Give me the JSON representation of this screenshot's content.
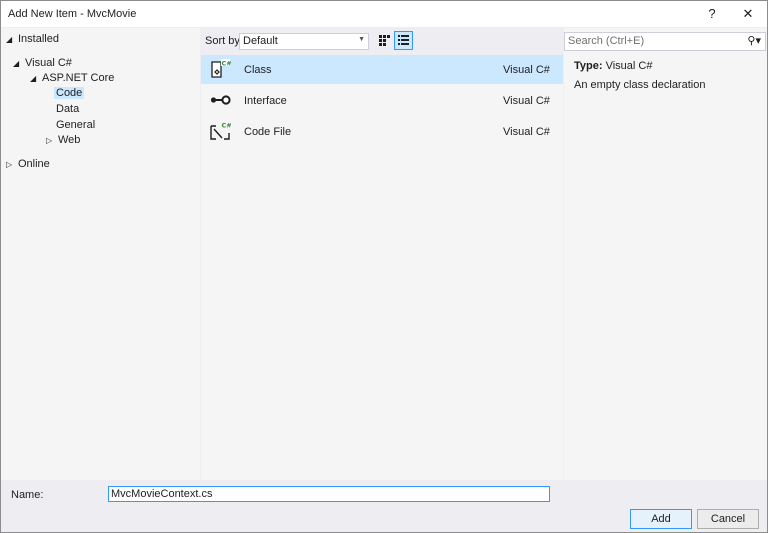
{
  "window": {
    "title": "Add New Item - MvcMovie",
    "help_label": "?",
    "close_label": "✕"
  },
  "tree": {
    "installed": "Installed",
    "visual_csharp": "Visual C#",
    "aspnet_core": "ASP.NET Core",
    "code": "Code",
    "data": "Data",
    "general": "General",
    "web": "Web",
    "online": "Online"
  },
  "toolbar": {
    "sort_label": "Sort by:",
    "sort_value": "Default"
  },
  "items": [
    {
      "name": "Class",
      "language": "Visual C#"
    },
    {
      "name": "Interface",
      "language": "Visual C#"
    },
    {
      "name": "Code File",
      "language": "Visual C#"
    }
  ],
  "details": {
    "search_placeholder": "Search (Ctrl+E)",
    "type_label": "Type:",
    "type_value": "Visual C#",
    "description": "An empty class declaration"
  },
  "footer": {
    "name_label": "Name:",
    "name_value": "MvcMovieContext.cs",
    "add_label": "Add",
    "cancel_label": "Cancel"
  },
  "colors": {
    "selection": "#cce8ff",
    "focus_border": "#3399ff",
    "csharp_green": "#388a34",
    "panel": "#f5f5f5",
    "chrome": "#eeeef2"
  }
}
